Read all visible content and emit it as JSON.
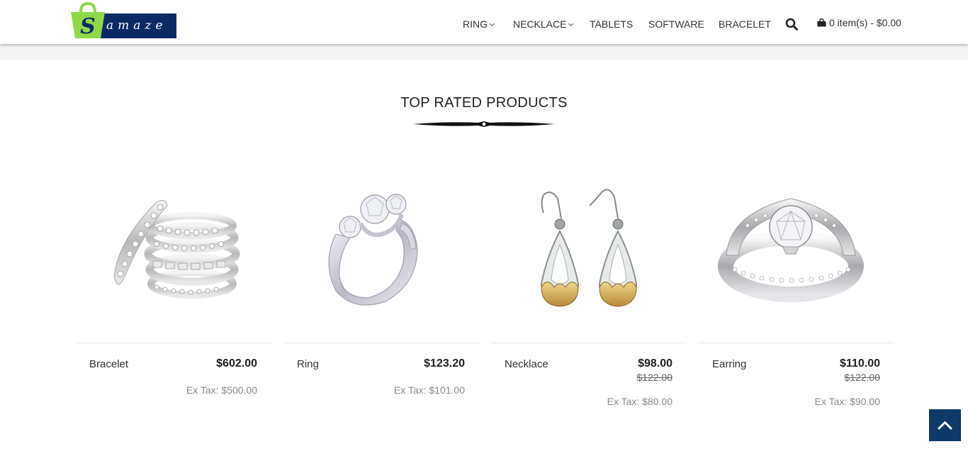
{
  "header": {
    "logo_text": "amaze",
    "nav": [
      {
        "label": "RING",
        "dropdown": true
      },
      {
        "label": "NECKLACE",
        "dropdown": true
      },
      {
        "label": "TABLETS",
        "dropdown": false
      },
      {
        "label": "SOFTWARE",
        "dropdown": false
      },
      {
        "label": "BRACELET",
        "dropdown": false
      }
    ],
    "cart_label": "0 item(s) - $0.00"
  },
  "section": {
    "title": "TOP RATED PRODUCTS"
  },
  "products": [
    {
      "name": "Bracelet",
      "price": "$602.00",
      "old_price": "",
      "ex_tax": "Ex Tax: $500.00",
      "image": "stacked-rings"
    },
    {
      "name": "Ring",
      "price": "$123.20",
      "old_price": "",
      "ex_tax": "Ex Tax: $101.00",
      "image": "three-stone-ring"
    },
    {
      "name": "Necklace",
      "price": "$98.00",
      "old_price": "$122.00",
      "ex_tax": "Ex Tax: $80.00",
      "image": "drop-earrings"
    },
    {
      "name": "Earring",
      "price": "$110.00",
      "old_price": "$122.00",
      "ex_tax": "Ex Tax: $90.00",
      "image": "solitaire-ring"
    }
  ],
  "colors": {
    "brand_navy": "#0a2a66",
    "brand_green": "#8ed94a",
    "scroll_top_bg": "#0d3868"
  },
  "icons": [
    "shopping-bag-icon",
    "search-icon",
    "cart-icon",
    "chevron-down-icon",
    "chevron-up-icon"
  ]
}
